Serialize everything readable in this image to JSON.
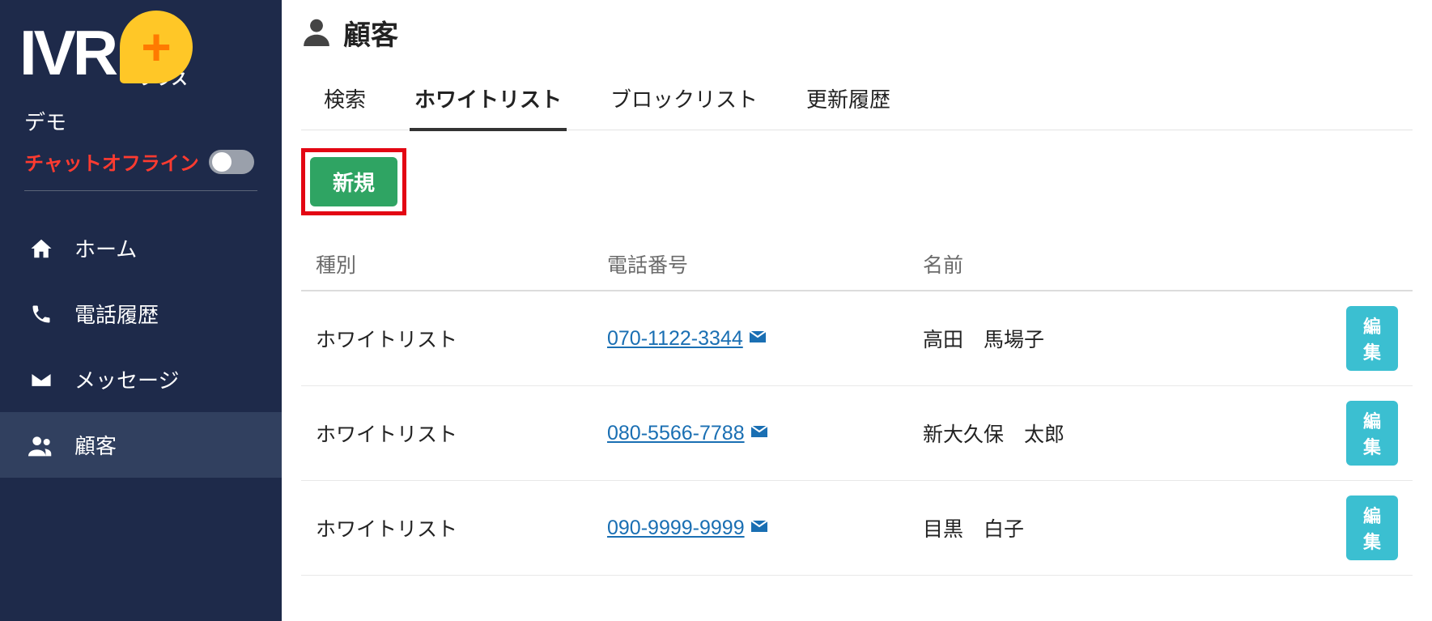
{
  "app": {
    "logo_main": "IVR",
    "logo_sub": "プラス",
    "tenant": "デモ",
    "chat_offline": "チャットオフライン"
  },
  "nav": {
    "home": {
      "label": "ホーム"
    },
    "calls": {
      "label": "電話履歴"
    },
    "msgs": {
      "label": "メッセージ"
    },
    "cust": {
      "label": "顧客"
    }
  },
  "page": {
    "title": "顧客"
  },
  "tabs": {
    "search": "検索",
    "whitelist": "ホワイトリスト",
    "blocklist": "ブロックリスト",
    "history": "更新履歴"
  },
  "buttons": {
    "new": "新規",
    "edit": "編集"
  },
  "columns": {
    "type": "種別",
    "phone": "電話番号",
    "name": "名前"
  },
  "rows": [
    {
      "type": "ホワイトリスト",
      "phone": "070-1122-3344",
      "name": "高田　馬場子"
    },
    {
      "type": "ホワイトリスト",
      "phone": "080-5566-7788",
      "name": "新大久保　太郎"
    },
    {
      "type": "ホワイトリスト",
      "phone": "090-9999-9999",
      "name": "目黒　白子"
    }
  ]
}
